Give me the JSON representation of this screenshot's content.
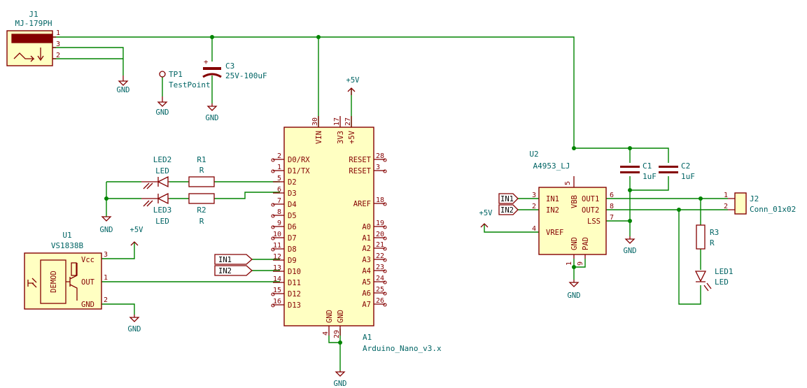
{
  "components": {
    "J1": {
      "ref": "J1",
      "value": "MJ-179PH",
      "pins": [
        "1",
        "3",
        "2"
      ]
    },
    "TP1": {
      "ref": "TP1",
      "value": "TestPoint"
    },
    "C3": {
      "ref": "C3",
      "value": "25V-100uF",
      "plus": "+"
    },
    "A1": {
      "ref": "A1",
      "value": "Arduino_Nano_v3.x",
      "top_pins": [
        {
          "name": "VIN",
          "num": "30"
        },
        {
          "name": "3V3",
          "num": "17"
        },
        {
          "name": "+5V",
          "num": "27"
        }
      ],
      "bottom_pins": [
        {
          "name": "GND",
          "num": "4"
        },
        {
          "name": "GND",
          "num": "29"
        }
      ],
      "left_pins": [
        {
          "name": "D0/RX",
          "num": "2"
        },
        {
          "name": "D1/TX",
          "num": "1"
        },
        {
          "name": "D2",
          "num": "5"
        },
        {
          "name": "D3",
          "num": "6"
        },
        {
          "name": "D4",
          "num": "7"
        },
        {
          "name": "D5",
          "num": "8"
        },
        {
          "name": "D6",
          "num": "9"
        },
        {
          "name": "D7",
          "num": "10"
        },
        {
          "name": "D8",
          "num": "11"
        },
        {
          "name": "D9",
          "num": "12"
        },
        {
          "name": "D10",
          "num": "13"
        },
        {
          "name": "D11",
          "num": "14"
        },
        {
          "name": "D12",
          "num": "15"
        },
        {
          "name": "D13",
          "num": "16"
        }
      ],
      "right_pins": [
        {
          "name": "RESET",
          "num": "28"
        },
        {
          "name": "RESET",
          "num": "3"
        },
        {
          "name": "AREF",
          "num": "18"
        },
        {
          "name": "A0",
          "num": "19"
        },
        {
          "name": "A1",
          "num": "20"
        },
        {
          "name": "A2",
          "num": "21"
        },
        {
          "name": "A3",
          "num": "22"
        },
        {
          "name": "A4",
          "num": "23"
        },
        {
          "name": "A5",
          "num": "24"
        },
        {
          "name": "A6",
          "num": "25"
        },
        {
          "name": "A7",
          "num": "26"
        }
      ]
    },
    "LED2": {
      "ref": "LED2",
      "value": "LED"
    },
    "LED3": {
      "ref": "LED3",
      "value": "LED"
    },
    "R1": {
      "ref": "R1",
      "value": "R"
    },
    "R2": {
      "ref": "R2",
      "value": "R"
    },
    "U1": {
      "ref": "U1",
      "value": "VS1838B",
      "demod": "DEMOD",
      "pins": [
        {
          "name": "Vcc",
          "num": "3"
        },
        {
          "name": "OUT",
          "num": "1"
        },
        {
          "name": "GND",
          "num": "2"
        }
      ]
    },
    "U2": {
      "ref": "U2",
      "value": "A4953_LJ",
      "left_pins": [
        {
          "name": "IN1",
          "num": "3"
        },
        {
          "name": "IN2",
          "num": "2"
        },
        {
          "name": "VREF",
          "num": "4"
        }
      ],
      "right_pins": [
        {
          "name": "OUT1",
          "num": "6"
        },
        {
          "name": "OUT2",
          "num": "8"
        },
        {
          "name": "LSS",
          "num": "7"
        }
      ],
      "top_pin": {
        "name": "VBB",
        "num": "5"
      },
      "bottom_pins": [
        {
          "name": "GND",
          "num": "1"
        },
        {
          "name": "PAD",
          "num": "9"
        }
      ]
    },
    "C1": {
      "ref": "C1",
      "value": "1uF"
    },
    "C2": {
      "ref": "C2",
      "value": "1uF"
    },
    "J2": {
      "ref": "J2",
      "value": "Conn_01x02",
      "pins": [
        "1",
        "2"
      ]
    },
    "R3": {
      "ref": "R3",
      "value": "R"
    },
    "LED1": {
      "ref": "LED1",
      "value": "LED"
    }
  },
  "power": {
    "gnd": "GND",
    "vcc": "+5V"
  },
  "net_labels": {
    "in1": "IN1",
    "in2": "IN2"
  }
}
